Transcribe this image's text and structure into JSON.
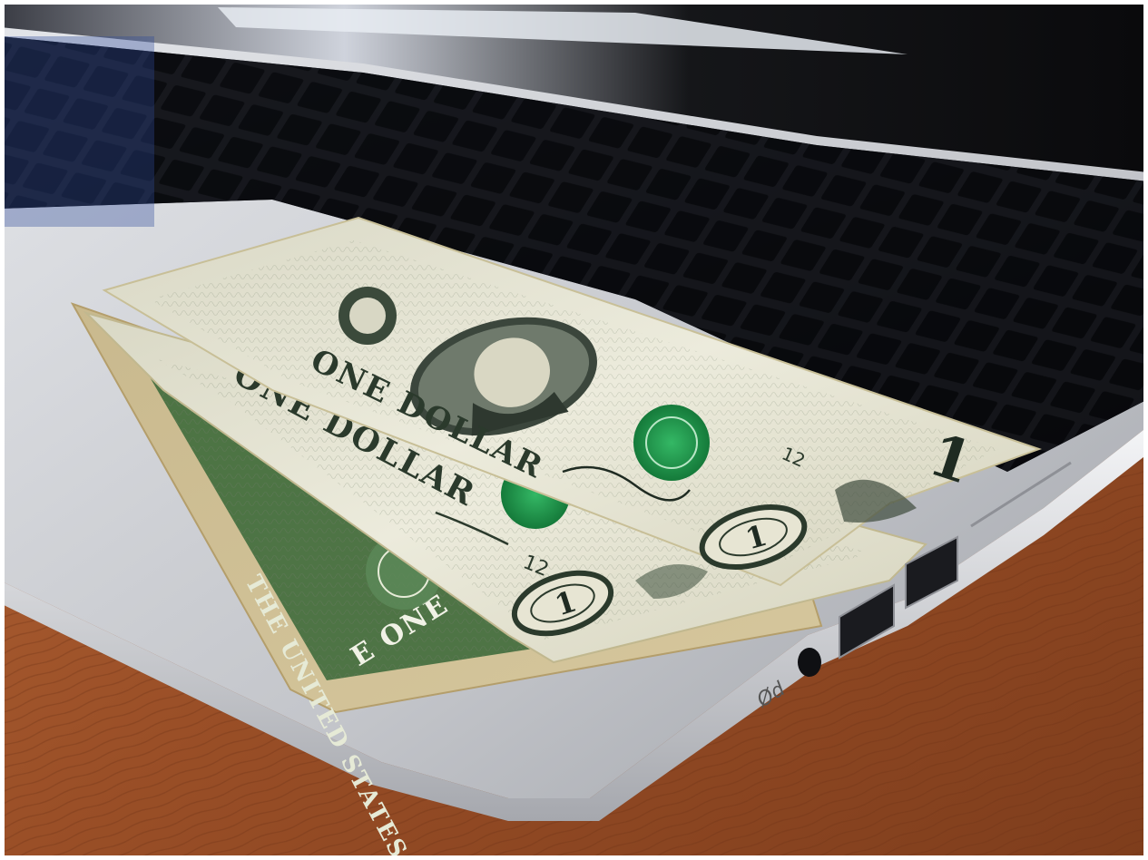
{
  "image": {
    "subject": "Three one-dollar bills lying on a silver laptop palm rest on a wooden desk",
    "colors": {
      "wood": "#a0532b",
      "laptop": "#c7c9cd",
      "keyboard": "#1c1d21",
      "bill_paper": "#e9e6d2",
      "bill_ink": "#2b3a2c",
      "seal_green": "#1f9a4d"
    }
  },
  "bills": [
    {
      "top_text": "ONE DOLLAR",
      "denomination": "1",
      "serial_fragment": "12"
    },
    {
      "top_text": "ONE DOLLAR",
      "denomination": "1",
      "serial_fragment": "12"
    },
    {
      "top_text": "THE UNITED STATES",
      "back_text": "E ONE",
      "denomination": "1"
    }
  ],
  "laptop": {
    "port_label": "Ød"
  }
}
